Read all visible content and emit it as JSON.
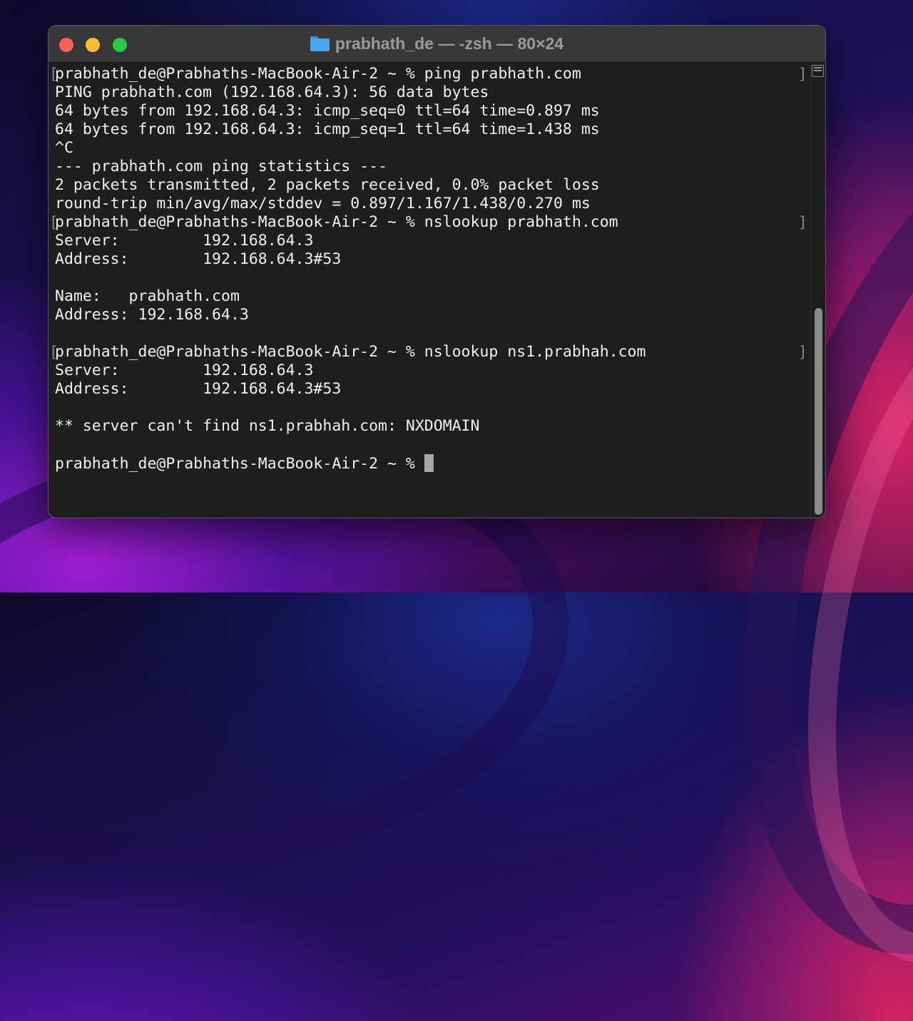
{
  "window": {
    "title": "prabhath_de — -zsh — 80×24",
    "title_icon": "folder-icon",
    "traffic_lights": {
      "close": "#ff5f57",
      "minimize": "#febc2e",
      "zoom": "#28c840"
    }
  },
  "terminal": {
    "background": "#1e1e1e",
    "foreground": "#f0f0f0",
    "lines": [
      {
        "text": "prabhath_de@Prabhaths-MacBook-Air-2 ~ % ping prabhath.com",
        "marked": true
      },
      {
        "text": "PING prabhath.com (192.168.64.3): 56 data bytes"
      },
      {
        "text": "64 bytes from 192.168.64.3: icmp_seq=0 ttl=64 time=0.897 ms"
      },
      {
        "text": "64 bytes from 192.168.64.3: icmp_seq=1 ttl=64 time=1.438 ms"
      },
      {
        "text": "^C"
      },
      {
        "text": "--- prabhath.com ping statistics ---"
      },
      {
        "text": "2 packets transmitted, 2 packets received, 0.0% packet loss"
      },
      {
        "text": "round-trip min/avg/max/stddev = 0.897/1.167/1.438/0.270 ms"
      },
      {
        "text": "prabhath_de@Prabhaths-MacBook-Air-2 ~ % nslookup prabhath.com",
        "marked": true
      },
      {
        "text": "Server:\t\t192.168.64.3"
      },
      {
        "text": "Address:\t192.168.64.3#53"
      },
      {
        "text": ""
      },
      {
        "text": "Name:\tprabhath.com"
      },
      {
        "text": "Address: 192.168.64.3"
      },
      {
        "text": ""
      },
      {
        "text": "prabhath_de@Prabhaths-MacBook-Air-2 ~ % nslookup ns1.prabhah.com",
        "marked": true
      },
      {
        "text": "Server:\t\t192.168.64.3"
      },
      {
        "text": "Address:\t192.168.64.3#53"
      },
      {
        "text": ""
      },
      {
        "text": "** server can't find ns1.prabhah.com: NXDOMAIN"
      },
      {
        "text": ""
      },
      {
        "text": "prabhath_de@Prabhaths-MacBook-Air-2 ~ % ",
        "cursor": true
      }
    ]
  },
  "scrollbar": {
    "thumb_start_fraction": 0.52,
    "thumb_end_fraction": 1.0
  }
}
